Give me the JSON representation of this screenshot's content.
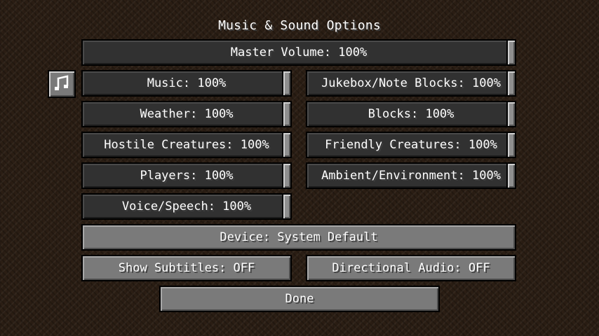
{
  "title": "Music & Sound Options",
  "master_volume": "Master Volume: 100%",
  "sound_sliders": {
    "music": "Music: 100%",
    "jukebox": "Jukebox/Note Blocks: 100%",
    "weather": "Weather: 100%",
    "blocks": "Blocks: 100%",
    "hostile": "Hostile Creatures: 100%",
    "friendly": "Friendly Creatures: 100%",
    "players": "Players: 100%",
    "ambient": "Ambient/Environment: 100%",
    "voice": "Voice/Speech: 100%"
  },
  "device": "Device: System Default",
  "subtitles": "Show Subtitles: OFF",
  "directional_audio": "Directional Audio: OFF",
  "done": "Done",
  "icons": {
    "music_note": "music-note-icon"
  },
  "colors": {
    "slider_background": "#313131",
    "slider_handle": "#8f8f8f",
    "button_background": "#7a7a7a",
    "text": "#ffffff",
    "background": "#2b1e14"
  }
}
